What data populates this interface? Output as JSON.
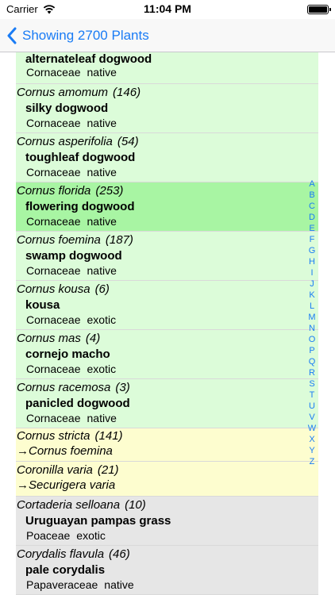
{
  "status_bar": {
    "carrier": "Carrier",
    "time": "11:04 PM"
  },
  "nav": {
    "back_label": "Showing 2700 Plants"
  },
  "rows": [
    {
      "type": "partial",
      "common": "alternateleaf dogwood",
      "family": "Cornaceae",
      "status": "native"
    },
    {
      "type": "native",
      "scientific": "Cornus amomum",
      "count": "(146)",
      "common": "silky dogwood",
      "family": "Cornaceae",
      "status": "native"
    },
    {
      "type": "native",
      "scientific": "Cornus asperifolia",
      "count": "(54)",
      "common": "toughleaf dogwood",
      "family": "Cornaceae",
      "status": "native"
    },
    {
      "type": "selected",
      "scientific": "Cornus florida",
      "count": "(253)",
      "common": "flowering dogwood",
      "family": "Cornaceae",
      "status": "native"
    },
    {
      "type": "native",
      "scientific": "Cornus foemina",
      "count": "(187)",
      "common": "swamp dogwood",
      "family": "Cornaceae",
      "status": "native"
    },
    {
      "type": "native",
      "scientific": "Cornus kousa",
      "count": "(6)",
      "common": "kousa",
      "family": "Cornaceae",
      "status": "exotic"
    },
    {
      "type": "native",
      "scientific": "Cornus mas",
      "count": "(4)",
      "common": "cornejo macho",
      "family": "Cornaceae",
      "status": "exotic"
    },
    {
      "type": "native",
      "scientific": "Cornus racemosa",
      "count": "(3)",
      "common": "panicled dogwood",
      "family": "Cornaceae",
      "status": "native"
    },
    {
      "type": "synonym",
      "scientific": "Cornus stricta",
      "count": "(141)",
      "synonym": "→Cornus foemina"
    },
    {
      "type": "synonym",
      "scientific": "Coronilla varia",
      "count": "(21)",
      "synonym": "→Securigera varia"
    },
    {
      "type": "exotic-gray",
      "scientific": "Cortaderia selloana",
      "count": "(10)",
      "common": "Uruguayan pampas grass",
      "family": "Poaceae",
      "status": "exotic"
    },
    {
      "type": "exotic-gray",
      "scientific": "Corydalis flavula",
      "count": "(46)",
      "common": "pale corydalis",
      "family": "Papaveraceae",
      "status": "native"
    }
  ],
  "index_letters": [
    "A",
    "B",
    "C",
    "D",
    "E",
    "F",
    "G",
    "H",
    "I",
    "J",
    "K",
    "L",
    "M",
    "N",
    "O",
    "P",
    "Q",
    "R",
    "S",
    "T",
    "U",
    "V",
    "W",
    "X",
    "Y",
    "Z"
  ],
  "colors": {
    "accent": "#1a7cf5",
    "native_bg": "#dcfcd9",
    "selected_bg": "#a8f5a3",
    "synonym_bg": "#fdfdcf",
    "gray_bg": "#e6e6e6"
  }
}
